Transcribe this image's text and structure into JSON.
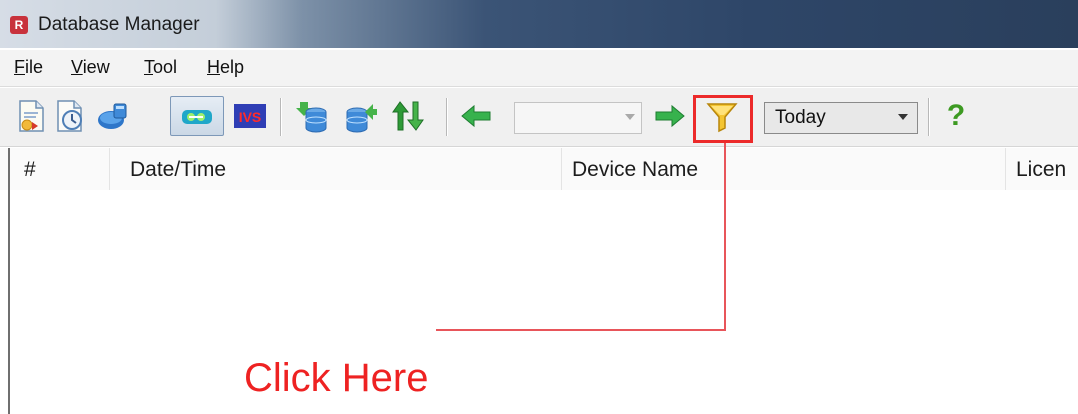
{
  "window": {
    "title": "Database Manager",
    "app_icon_glyph": "R"
  },
  "menu": {
    "items": [
      {
        "underline": "F",
        "rest": "ile"
      },
      {
        "underline": "V",
        "rest": "iew"
      },
      {
        "underline": "T",
        "rest": "ool"
      },
      {
        "underline": "H",
        "rest": "elp"
      }
    ]
  },
  "toolbar": {
    "icons": [
      "export-report-icon",
      "schedule-backup-icon",
      "network-globe-icon",
      "live-view-icon",
      "ivs-icon",
      "db-import-icon",
      "db-export-icon",
      "sync-arrows-icon",
      "arrow-left-icon",
      "arrow-right-icon",
      "filter-funnel-icon",
      "help-icon"
    ],
    "ivs_label": "IVS",
    "nav_combo_value": "",
    "date_combo_value": "Today",
    "help_glyph": "?"
  },
  "table": {
    "columns": [
      "#",
      "Date/Time",
      "Device Name",
      "Licen"
    ]
  },
  "annotation": {
    "text": "Click Here",
    "color": "#ee2222"
  }
}
